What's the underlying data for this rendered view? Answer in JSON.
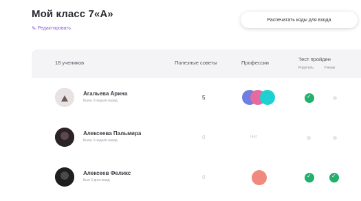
{
  "header": {
    "title": "Мой класс 7«А»",
    "edit_label": "Редактировать",
    "print_button": "Распечатать коды для входа"
  },
  "table": {
    "students_count": "18 учеников",
    "col_points": "Полезные советы",
    "col_profession": "Профессии",
    "col_test": "Тест пройден",
    "col_test_sub1": "Родитель",
    "col_test_sub2": "Ученик"
  },
  "rows": [
    {
      "name": "Агальева Арина",
      "sub": "Была 3 недели назад",
      "points": "5",
      "profession_text": "",
      "profession_colors": [
        "#6f7ee0",
        "#e56aa0",
        "#1fd0d0"
      ],
      "test_parent": true,
      "test_student": false
    },
    {
      "name": "Алексеева Пальмира",
      "sub": "Была 3 недели назад",
      "points": "0",
      "profession_text": "Нет",
      "profession_colors": [],
      "test_parent": false,
      "test_student": false
    },
    {
      "name": "Алексеев Феликс",
      "sub": "Был 3 дня назад",
      "points": "0",
      "profession_text": "",
      "profession_colors": [
        "#f08a7e"
      ],
      "test_parent": true,
      "test_student": true
    }
  ],
  "colors": {
    "accent": "#8a5be0",
    "success": "#22b06a",
    "header_bg": "#f4f4f6"
  }
}
